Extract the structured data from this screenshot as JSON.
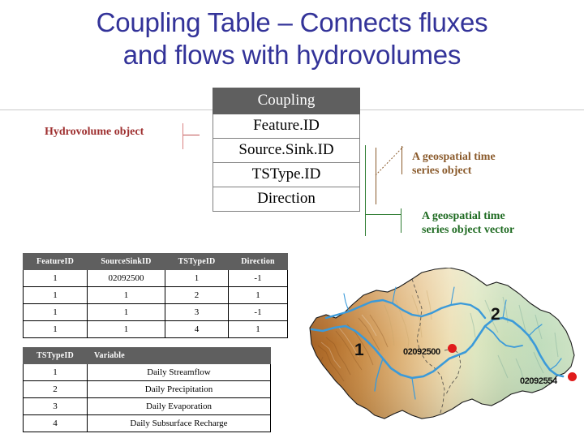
{
  "title": "Coupling Table – Connects fluxes and flows with hydrovolumes",
  "title_line1": "Coupling Table – Connects fluxes",
  "title_line2": "and flows with hydrovolumes",
  "colors": {
    "title": "#333399",
    "table_header_bg": "#5f5f5f",
    "hydrovolume_label": "#9e2f2f",
    "timeseries_object_label": "#8a5a2b",
    "timeseries_vector_label": "#1f6b22",
    "gauge_marker": "#e01b1b",
    "stream": "#3b9ad9"
  },
  "schema": {
    "header": "Coupling",
    "fields": [
      "Feature.ID",
      "Source.Sink.ID",
      "TSType.ID",
      "Direction"
    ]
  },
  "annotations": {
    "hydrovolume": "Hydrovolume object",
    "timeseries_object_line1": "A geospatial time",
    "timeseries_object_line2": "series object",
    "timeseries_vector_line1": "A geospatial time",
    "timeseries_vector_line2": "series object vector"
  },
  "coupling_data": {
    "columns": [
      "FeatureID",
      "SourceSinkID",
      "TSTypeID",
      "Direction"
    ],
    "rows": [
      [
        "1",
        "02092500",
        "1",
        "-1"
      ],
      [
        "1",
        "1",
        "2",
        "1"
      ],
      [
        "1",
        "1",
        "3",
        "-1"
      ],
      [
        "1",
        "1",
        "4",
        "1"
      ]
    ]
  },
  "tstype_data": {
    "columns": [
      "TSTypeID",
      "Variable"
    ],
    "rows": [
      [
        "1",
        "Daily Streamflow"
      ],
      [
        "2",
        "Daily Precipitation"
      ],
      [
        "3",
        "Daily Evaporation"
      ],
      [
        "4",
        "Daily Subsurface Recharge"
      ]
    ]
  },
  "map": {
    "basin_labels": [
      "1",
      "2"
    ],
    "gauges": [
      "02092500",
      "02092554"
    ]
  }
}
